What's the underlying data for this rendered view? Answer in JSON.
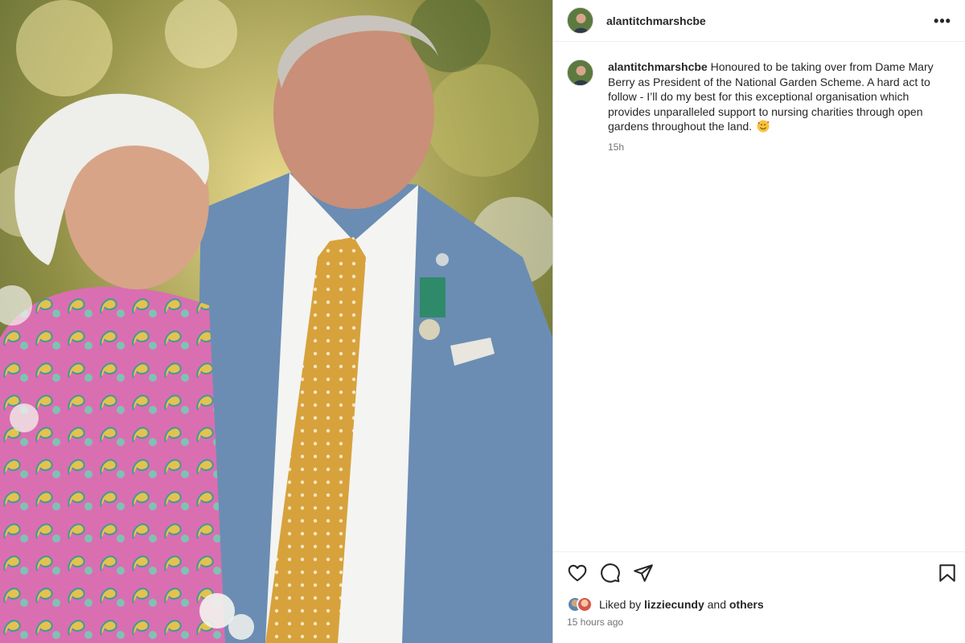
{
  "post": {
    "username": "alantitchmarshcbe",
    "more_label": "•••",
    "caption_user": "alantitchmarshcbe",
    "caption_text": "Honoured to be taking over from Dame Mary Berry as President of the National Garden Scheme. A hard act to follow - I’ll do my best for this exceptional organisation which provides unparalleled support to nursing charities through open gardens throughout the land.",
    "caption_emoji": "smiling-face-with-hearts",
    "caption_time": "15h",
    "likes_prefix": "Liked by ",
    "likes_user": "lizziecundy",
    "likes_middle": " and ",
    "likes_others": "others",
    "posted_ago": "15 hours ago"
  },
  "icons": {
    "like": "heart-icon",
    "comment": "comment-icon",
    "share": "paper-plane-icon",
    "save": "bookmark-icon",
    "more": "more-icon"
  },
  "colors": {
    "text": "#262626",
    "secondary": "#737373",
    "border": "#dbdbdb",
    "tie": "#d9a53a",
    "suit": "#6b8db3"
  }
}
